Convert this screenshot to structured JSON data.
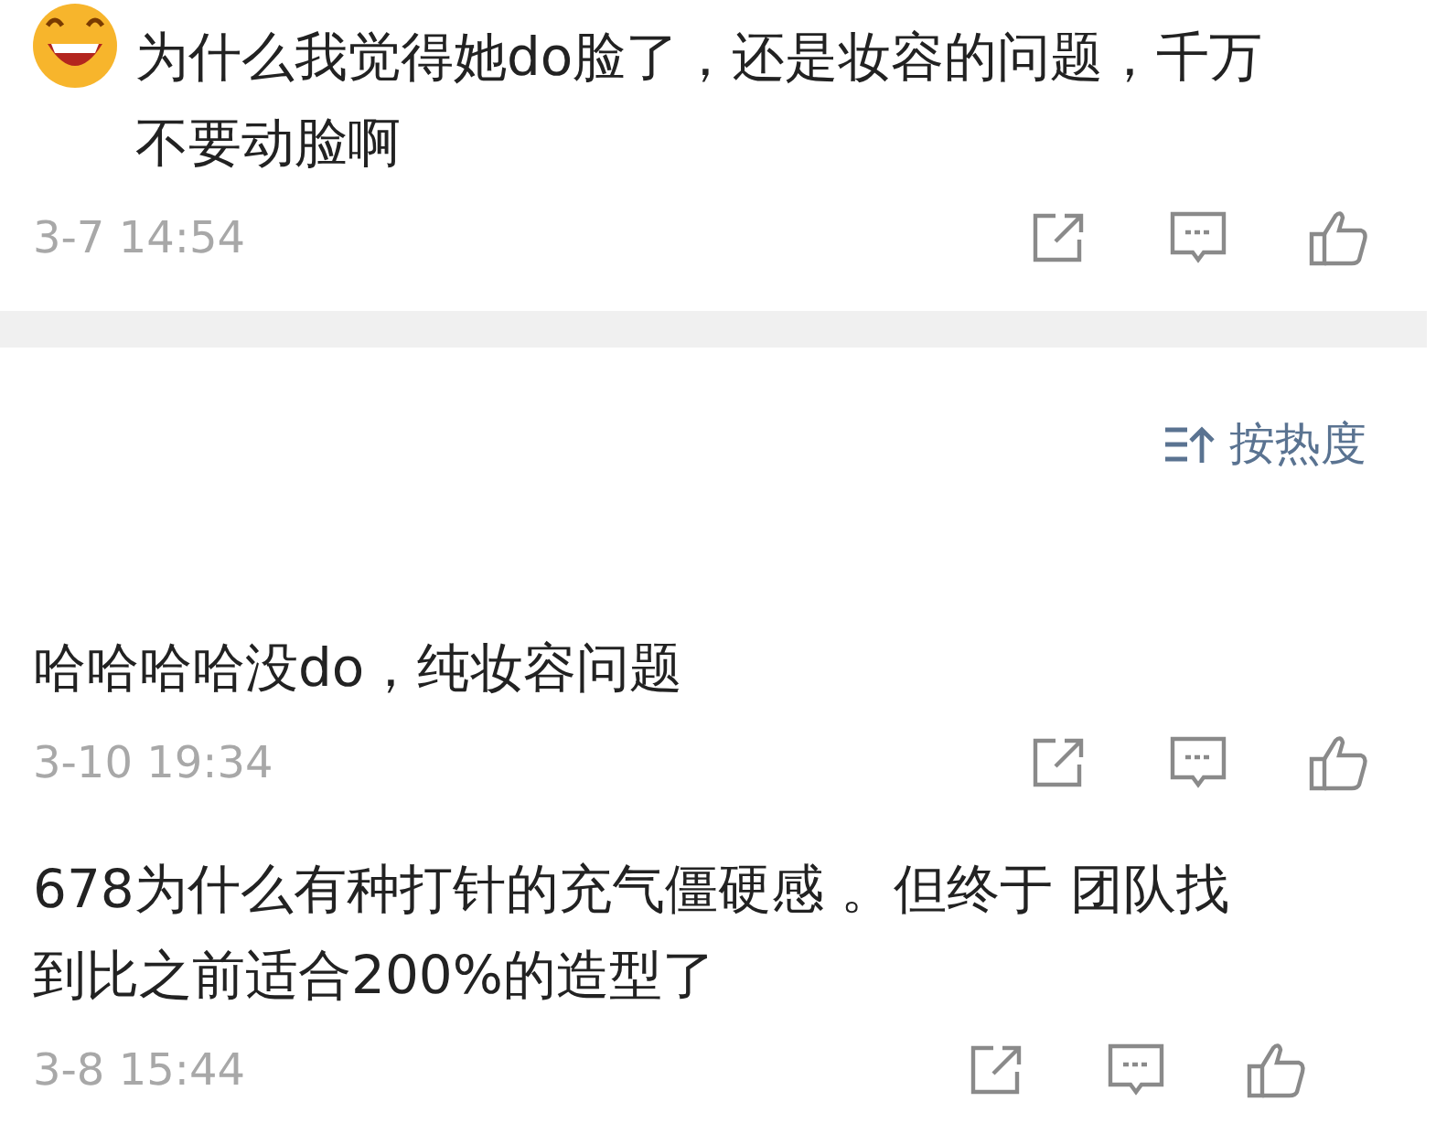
{
  "comments": [
    {
      "emoji_prefix": true,
      "text": "为什么我觉得她do脸了，还是妆容的问题，千万不要动脸啊",
      "time": "3-7 14:54"
    },
    {
      "emoji_prefix": false,
      "text": "哈哈哈哈没do，纯妆容问题",
      "time": "3-10 19:34"
    },
    {
      "emoji_prefix": false,
      "text": "678为什么有种打针的充气僵硬感 。但终于 团队找到比之前适合200%的造型了",
      "time": "3-8 15:44"
    }
  ],
  "sort": {
    "label": "按热度"
  }
}
